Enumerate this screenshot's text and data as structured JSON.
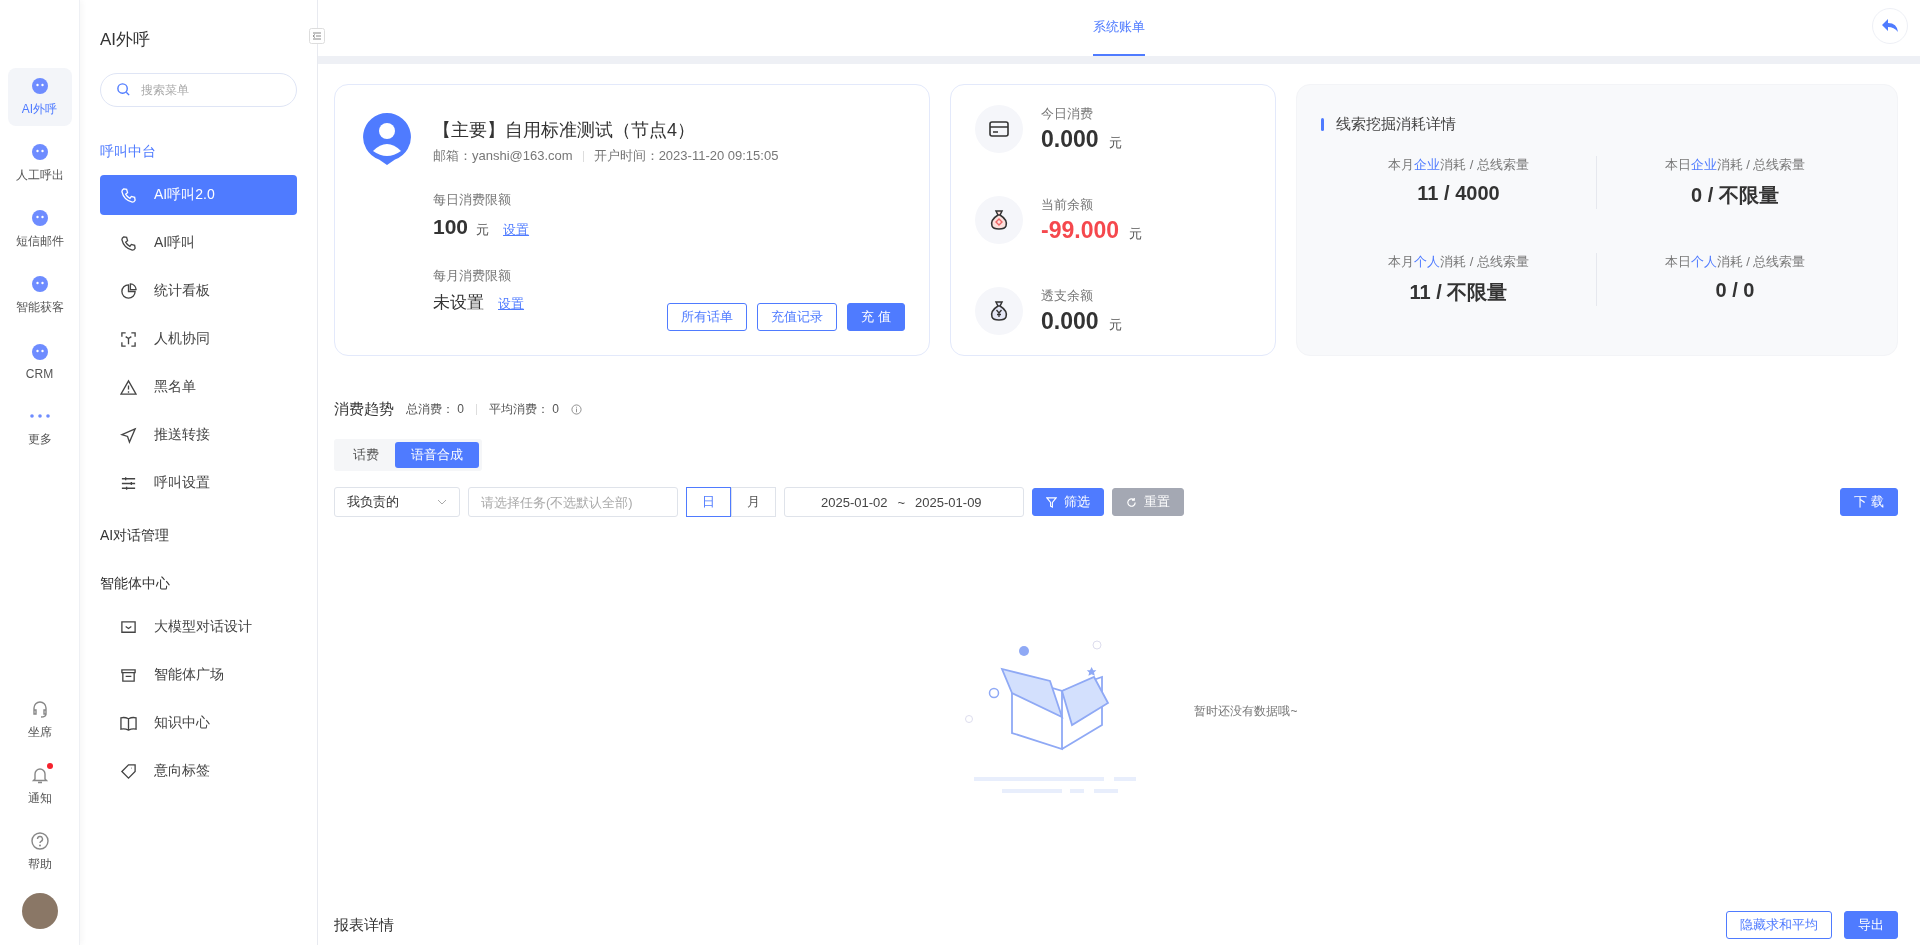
{
  "rail": {
    "items": [
      {
        "label": "AI外呼",
        "selected": true
      },
      {
        "label": "人工呼出",
        "selected": false
      },
      {
        "label": "短信邮件",
        "selected": false
      },
      {
        "label": "智能获客",
        "selected": false
      },
      {
        "label": "CRM",
        "selected": false
      },
      {
        "label": "更多",
        "selected": false
      }
    ],
    "bottom": [
      {
        "label": "坐席",
        "badge": false
      },
      {
        "label": "通知",
        "badge": true
      },
      {
        "label": "帮助",
        "badge": false
      }
    ]
  },
  "sidebar": {
    "title": "AI外呼",
    "search": {
      "placeholder": "搜索菜单"
    },
    "groups": [
      {
        "label": "呼叫中台",
        "active": true,
        "children": [
          {
            "label": "AI呼叫2.0",
            "selected": true
          },
          {
            "label": "AI呼叫",
            "selected": false
          },
          {
            "label": "统计看板",
            "selected": false
          },
          {
            "label": "人机协同",
            "selected": false
          },
          {
            "label": "黑名单",
            "selected": false
          },
          {
            "label": "推送转接",
            "selected": false
          },
          {
            "label": "呼叫设置",
            "selected": false
          }
        ]
      },
      {
        "label": "AI对话管理",
        "active": false
      },
      {
        "label": "智能体中心",
        "active": false,
        "children": [
          {
            "label": "大模型对话设计",
            "selected": false
          },
          {
            "label": "智能体广场",
            "selected": false
          },
          {
            "label": "知识中心",
            "selected": false
          },
          {
            "label": "意向标签",
            "selected": false
          }
        ]
      }
    ]
  },
  "header": {
    "tabs": [
      {
        "label": "系统账单",
        "selected": true
      }
    ]
  },
  "account": {
    "title": "【主要】自用标准测试（节点4）",
    "email": "邮箱：yanshi@163.com",
    "opened": "开户时间：2023-11-20 09:15:05",
    "limits": [
      {
        "label": "每日消费限额",
        "value": "100",
        "unit": "元",
        "link": "设置"
      },
      {
        "label": "每月消费限额",
        "value": "未设置",
        "link": "设置"
      }
    ],
    "buttons": [
      {
        "label": "所有话单",
        "kind": "outline"
      },
      {
        "label": "充值记录",
        "kind": "outline"
      },
      {
        "label": "充 值",
        "kind": "primary"
      }
    ]
  },
  "balances": [
    {
      "label": "今日消费",
      "value": "0.000",
      "unit": "元",
      "negative": false
    },
    {
      "label": "当前余额",
      "value": "-99.000",
      "unit": "元",
      "negative": true
    },
    {
      "label": "透支余额",
      "value": "0.000",
      "unit": "元",
      "negative": false
    }
  ],
  "leads": {
    "title": "线索挖掘消耗详情",
    "stats": [
      {
        "prefix": "本月",
        "highlight": "企业",
        "suffix": "消耗 / 总线索量",
        "value": "11 / 4000"
      },
      {
        "prefix": "本日",
        "highlight": "企业",
        "suffix": "消耗 / 总线索量",
        "value": "0 / 不限量"
      },
      {
        "prefix": "本月",
        "highlight": "个人",
        "suffix": "消耗 / 总线索量",
        "value": "11 / 不限量"
      },
      {
        "prefix": "本日",
        "highlight": "个人",
        "suffix": "消耗 / 总线索量",
        "value": "0 / 0"
      }
    ]
  },
  "trend": {
    "title": "消费趋势",
    "summary": [
      {
        "label": "总消费：",
        "value": "0"
      },
      {
        "label": "平均消费：",
        "value": "0"
      }
    ],
    "tabs": [
      {
        "label": "话费",
        "selected": false
      },
      {
        "label": "语音合成",
        "selected": true
      }
    ],
    "owner_select": {
      "value": "我负责的"
    },
    "task_select": {
      "placeholder": "请选择任务(不选默认全部)"
    },
    "granularity": [
      {
        "label": "日",
        "selected": true
      },
      {
        "label": "月",
        "selected": false
      }
    ],
    "date_range": {
      "start": "2025-01-02",
      "separator": "~",
      "end": "2025-01-09"
    },
    "filter_button": "筛选",
    "reset_button": "重置",
    "download_button": "下 载",
    "empty_text": "暂时还没有数据哦~"
  },
  "report": {
    "title": "报表详情",
    "buttons": [
      {
        "label": "隐藏求和平均",
        "kind": "outline"
      },
      {
        "label": "导出",
        "kind": "primary"
      }
    ]
  }
}
